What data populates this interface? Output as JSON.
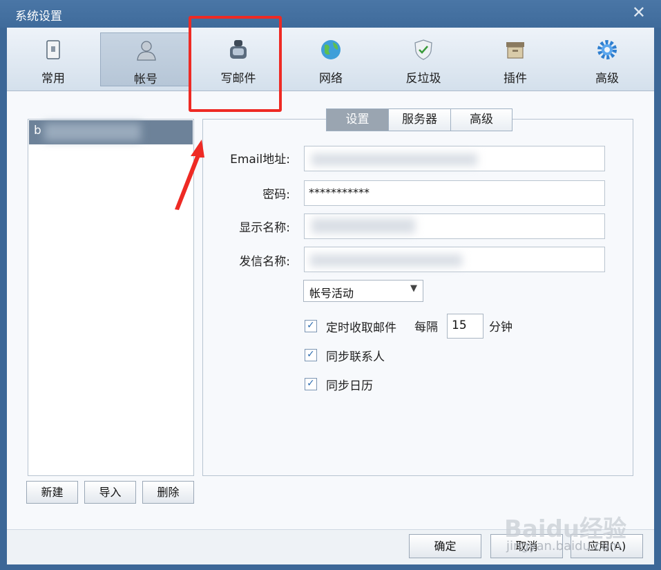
{
  "window": {
    "title": "系统设置",
    "close_icon": "close-icon"
  },
  "toolbar": {
    "items": [
      {
        "label": "常用",
        "icon": "general-icon"
      },
      {
        "label": "帐号",
        "icon": "user-icon"
      },
      {
        "label": "写邮件",
        "icon": "compose-icon"
      },
      {
        "label": "网络",
        "icon": "globe-icon"
      },
      {
        "label": "反垃圾",
        "icon": "shield-icon"
      },
      {
        "label": "插件",
        "icon": "box-icon"
      },
      {
        "label": "高级",
        "icon": "gear-icon"
      }
    ],
    "active": "帐号"
  },
  "accounts": {
    "items": [
      {
        "label": "b"
      }
    ],
    "buttons": {
      "new": "新建",
      "import": "导入",
      "delete": "删除"
    }
  },
  "tabs": [
    {
      "label": "设置"
    },
    {
      "label": "服务器"
    },
    {
      "label": "高级"
    }
  ],
  "form": {
    "email_label": "Email地址:",
    "password_label": "密码:",
    "password_value": "***********",
    "display_name_label": "显示名称:",
    "sender_name_label": "发信名称:",
    "status_select": "帐号活动",
    "auto_fetch": {
      "label": "定时收取邮件",
      "checked": true,
      "every": "每隔",
      "interval": "15",
      "unit": "分钟"
    },
    "sync_contacts": {
      "label": "同步联系人",
      "checked": true
    },
    "sync_calendar": {
      "label": "同步日历",
      "checked": true
    }
  },
  "footer": {
    "ok": "确定",
    "cancel": "取消",
    "apply": "应用(A)"
  },
  "watermark": {
    "text": "Baidu经验",
    "url": "jingyan.baidu.com"
  },
  "colors": {
    "highlight": "#ee2a24",
    "title_bar": "#3f6b9b",
    "accent": "#2f6eb0"
  }
}
